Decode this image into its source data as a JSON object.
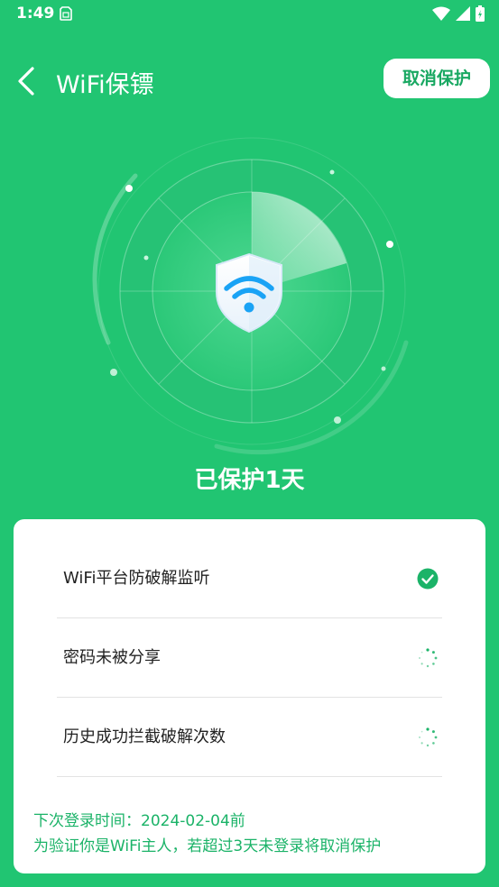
{
  "status_bar": {
    "time": "1:49"
  },
  "header": {
    "title": "WiFi保镖",
    "cancel_label": "取消保护"
  },
  "colors": {
    "brand": "#21c572",
    "brand_dark": "#19a862",
    "shield_blue": "#1aa3f5",
    "check_green": "#1bb368"
  },
  "status_title": "已保护1天",
  "checks": [
    {
      "label": "WiFi平台防破解监听",
      "state": "done"
    },
    {
      "label": "密码未被分享",
      "state": "loading"
    },
    {
      "label": "历史成功拦截破解次数",
      "state": "loading"
    }
  ],
  "notes": {
    "next_login": "下次登录时间：2024-02-04前",
    "warning": "为验证你是WiFi主人，若超过3天未登录将取消保护"
  }
}
